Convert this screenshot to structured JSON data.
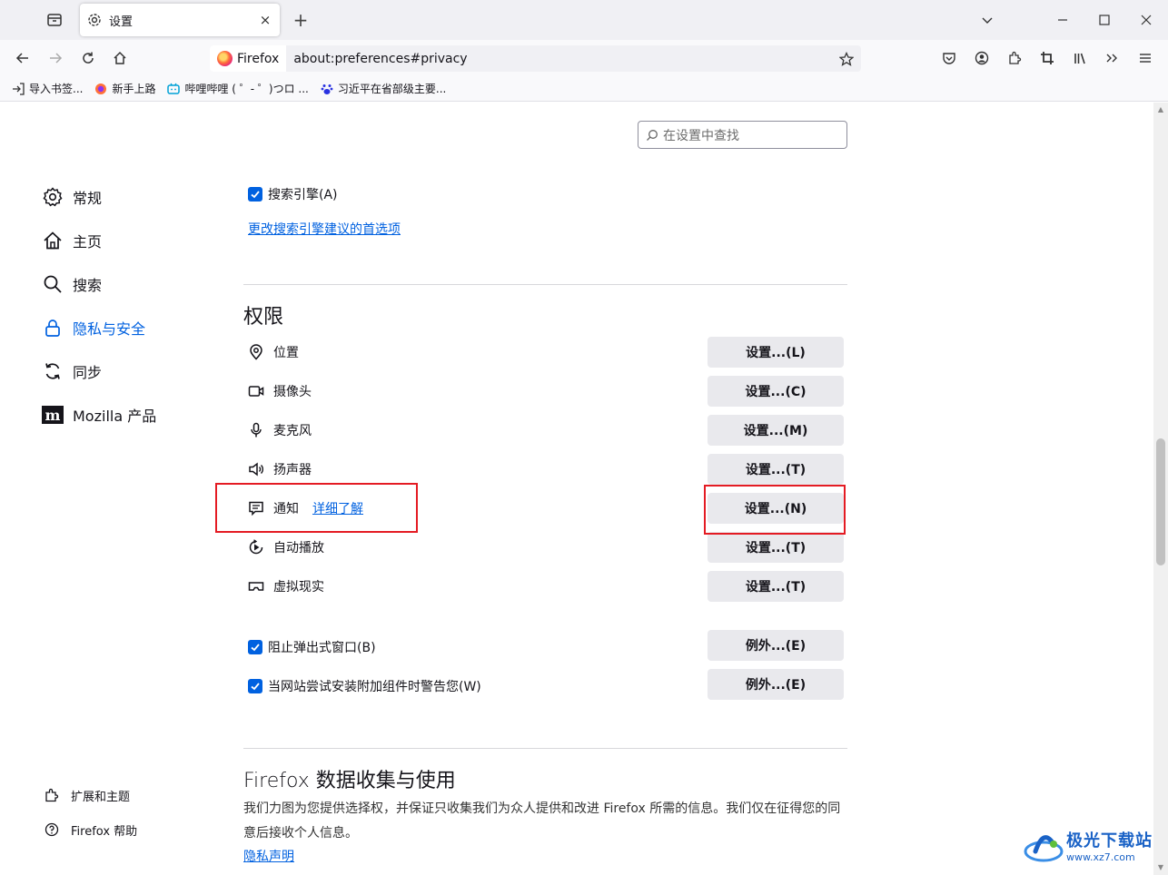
{
  "tab": {
    "title": "设置",
    "close": "×"
  },
  "new_tab": "+",
  "urlbar": {
    "identity": "Firefox",
    "url": "about:preferences#privacy"
  },
  "bookmarks": [
    {
      "label": "导入书签...",
      "icon": "import-icon"
    },
    {
      "label": "新手上路",
      "icon": "firefox-icon"
    },
    {
      "label": "哔哩哔哩 ( ゜- ゜)つロ ...",
      "icon": "bilibili-icon"
    },
    {
      "label": "习近平在省部级主要...",
      "icon": "baidu-icon"
    }
  ],
  "search": {
    "placeholder": "在设置中查找"
  },
  "sidebar": {
    "items": [
      {
        "label": "常规",
        "icon": "gear-icon"
      },
      {
        "label": "主页",
        "icon": "home-icon"
      },
      {
        "label": "搜索",
        "icon": "search-icon"
      },
      {
        "label": "隐私与安全",
        "icon": "lock-icon",
        "active": true
      },
      {
        "label": "同步",
        "icon": "sync-icon"
      },
      {
        "label": "Mozilla 产品",
        "icon": "mozilla-icon"
      }
    ],
    "bottom": [
      {
        "label": "扩展和主题",
        "icon": "puzzle-icon"
      },
      {
        "label": "Firefox 帮助",
        "icon": "help-icon"
      }
    ]
  },
  "search_suggestions": {
    "checkbox_label": "搜索引擎(A)",
    "link": "更改搜索引擎建议的首选项"
  },
  "permissions": {
    "title": "权限",
    "rows": [
      {
        "label": "位置",
        "icon": "location-icon",
        "button": "设置...(L)"
      },
      {
        "label": "摄像头",
        "icon": "camera-icon",
        "button": "设置...(C)"
      },
      {
        "label": "麦克风",
        "icon": "microphone-icon",
        "button": "设置...(M)"
      },
      {
        "label": "扬声器",
        "icon": "speaker-icon",
        "button": "设置...(T)"
      },
      {
        "label": "通知",
        "icon": "notification-icon",
        "button": "设置...(N)",
        "learn_more": "详细了解"
      },
      {
        "label": "自动播放",
        "icon": "autoplay-icon",
        "button": "设置...(T)"
      },
      {
        "label": "虚拟现实",
        "icon": "vr-icon",
        "button": "设置...(T)"
      }
    ],
    "block_popups": {
      "label": "阻止弹出式窗口(B)",
      "button": "例外...(E)"
    },
    "warn_addons": {
      "label": "当网站尝试安装附加组件时警告您(W)",
      "button": "例外...(E)"
    }
  },
  "data_collection": {
    "title": "Firefox 数据收集与使用",
    "description": "我们力图为您提供选择权，并保证只收集我们为众人提供和改进 Firefox 所需的信息。我们仅在征得您的同意后接收个人信息。",
    "privacy_link": "隐私声明"
  },
  "watermark": {
    "title": "极光下载站",
    "url": "www.xz7.com"
  },
  "colors": {
    "accent": "#0061e0",
    "highlight": "#e41b23",
    "button_bg": "#e9e9ed"
  }
}
